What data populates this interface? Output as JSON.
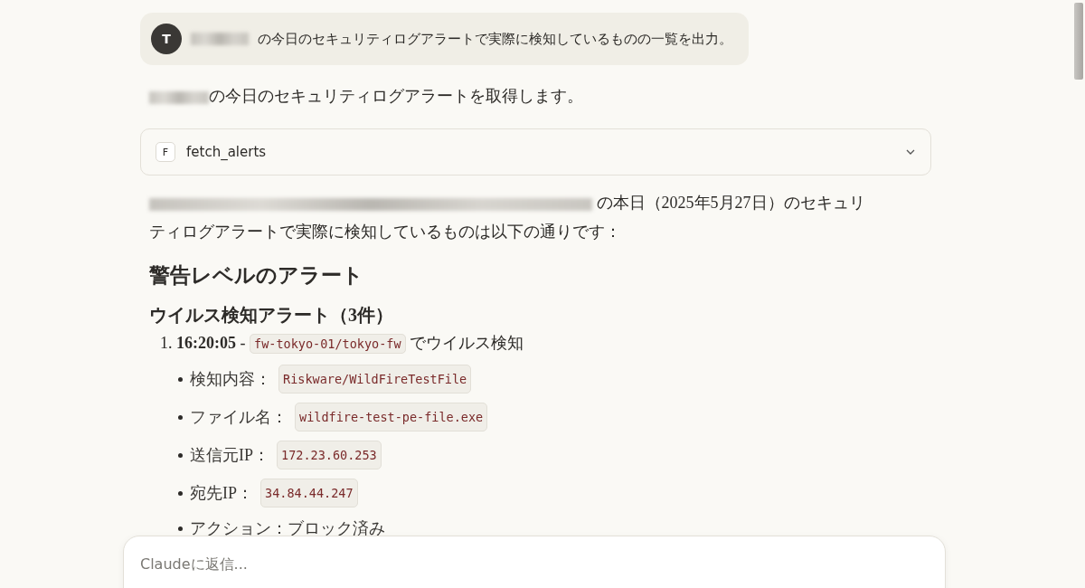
{
  "user_message": {
    "avatar": "T",
    "redacted_prefix": true,
    "text": "の今日のセキュリティログアラートで実際に検知しているものの一覧を出力。"
  },
  "intro": {
    "redacted_prefix": true,
    "text": "の今日のセキュリティログアラートを取得します。"
  },
  "tool_call": {
    "icon_letter": "F",
    "name": "fetch_alerts",
    "expanded": false
  },
  "summary": {
    "redacted_prefix": true,
    "text": " の本日（2025年5月27日）のセキュリ",
    "continuation": "ティログアラートで実際に検知しているものは以下の通りです："
  },
  "heading": "警告レベルのアラート",
  "subheading": "ウイルス検知アラート（3件）",
  "alerts": [
    {
      "number": "1.",
      "time": "16:20:05",
      "separator": " - ",
      "device": "fw-tokyo-01/tokyo-fw",
      "suffix": " でウイルス検知",
      "details": [
        {
          "label": "検知内容：",
          "code": "Riskware/WildFireTestFile"
        },
        {
          "label": "ファイル名：",
          "code": "wildfire-test-pe-file.exe"
        },
        {
          "label": "送信元IP：",
          "code": "172.23.60.253"
        },
        {
          "label": "宛先IP：",
          "code": "34.84.44.247"
        },
        {
          "label": "アクション：ブロック済み"
        }
      ]
    }
  ],
  "reply_box": {
    "placeholder": "Claudeに返信..."
  }
}
